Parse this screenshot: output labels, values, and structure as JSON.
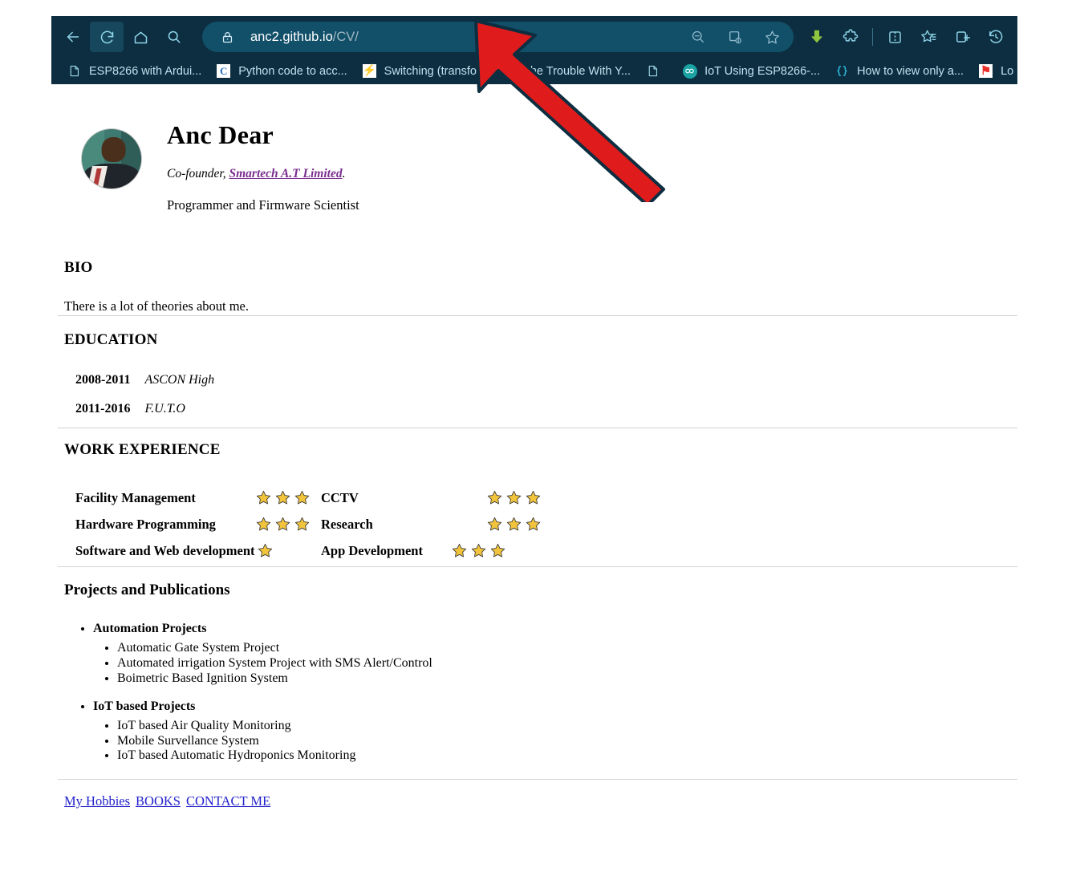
{
  "browser": {
    "toolbar": {
      "back_icon": "back-arrow-icon",
      "reload_icon": "reload-icon",
      "home_icon": "home-icon",
      "search_icon": "search-icon",
      "lock_icon": "lock-icon",
      "url_host": "anc2.github.io",
      "url_path": "/CV/",
      "url_full": "anc2.github.io/CV/",
      "zoom_out_icon": "zoom-out-icon",
      "save_page_icon": "save-page-icon",
      "favorite_icon": "star-icon",
      "downloads_icon": "downloads-arrow-icon",
      "extensions_icon": "extensions-puzzle-icon",
      "split_screen_icon": "split-screen-icon",
      "collections_icon": "collections-icon",
      "add_tab_group_icon": "add-tab-group-icon",
      "history_icon": "history-clock-icon"
    },
    "bookmarks": [
      {
        "label": "ESP8266 with Ardui...",
        "icon": "document-favicon"
      },
      {
        "label": "Python code to acc...",
        "icon": "letter-c-favicon"
      },
      {
        "label": "Switching (transfo...",
        "icon": "lightning-bolt-favicon"
      },
      {
        "label": "The Trouble With Y...",
        "icon": "news-favicon"
      },
      {
        "label": "",
        "icon": "document-favicon"
      },
      {
        "label": "IoT Using ESP8266-...",
        "icon": "arduino-favicon"
      },
      {
        "label": "How to view only a...",
        "icon": "code-brackets-favicon"
      },
      {
        "label": "Lo",
        "icon": "flag-favicon"
      }
    ]
  },
  "annotation": {
    "arrow_color": "#e01b1b",
    "arrow_outline": "#0c2e40",
    "name": "red-pointer-arrow"
  },
  "page": {
    "profile": {
      "avatar_alt": "profile-photo",
      "name": "Anc Dear",
      "role_prefix": "Co-founder,",
      "role_link": "Smartech A.T Limited",
      "role_suffix": ".",
      "title": "Programmer and Firmware Scientist"
    },
    "bio": {
      "heading": "BIO",
      "text": "There is a lot of theories about me."
    },
    "education": {
      "heading": "EDUCATION",
      "rows": [
        {
          "years": "2008-2011",
          "school": "ASCON High"
        },
        {
          "years": "2011-2016",
          "school": "F.U.T.O"
        }
      ]
    },
    "work": {
      "heading": "WORK EXPERIENCE",
      "rows": [
        {
          "left_name": "Facility Management",
          "left_stars": 3,
          "right_name": "CCTV",
          "right_stars": 3
        },
        {
          "left_name": "Hardware Programming",
          "left_stars": 3,
          "right_name": "Research",
          "right_stars": 3
        },
        {
          "left_name": "Software and Web development",
          "left_stars": 1,
          "right_name": "App Development",
          "right_stars": 3
        }
      ],
      "star_color": "#f2c43c"
    },
    "projects": {
      "heading": "Projects and Publications",
      "groups": [
        {
          "title": "Automation Projects",
          "items": [
            "Automatic Gate System Project",
            "Automated irrigation System Project with SMS Alert/Control",
            "Boimetric Based Ignition System"
          ]
        },
        {
          "title": "IoT based Projects",
          "items": [
            "IoT based Air Quality Monitoring",
            "Mobile Survellance System",
            "IoT based Automatic Hydroponics Monitoring"
          ]
        }
      ]
    },
    "footer": {
      "links": [
        "My Hobbies",
        "BOOKS",
        "CONTACT ME"
      ],
      "link_color": "#2222cc"
    }
  }
}
